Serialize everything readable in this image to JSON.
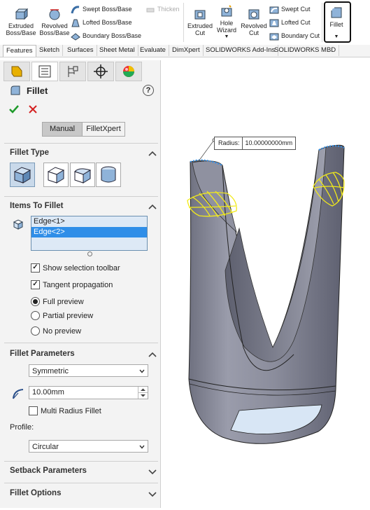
{
  "ribbon": {
    "extruded_boss": "Extruded Boss/Base",
    "revolved_boss": "Revolved Boss/Base",
    "swept_boss": "Swept Boss/Base",
    "lofted_boss": "Lofted Boss/Base",
    "boundary_boss": "Boundary Boss/Base",
    "thicken": "Thicken",
    "extruded_cut": "Extruded Cut",
    "hole_wizard": "Hole Wizard",
    "revolved_cut": "Revolved Cut",
    "swept_cut": "Swept Cut",
    "lofted_cut": "Lofted Cut",
    "boundary_cut": "Boundary Cut",
    "fillet": "Fillet"
  },
  "tabs": [
    "Features",
    "Sketch",
    "Surfaces",
    "Sheet Metal",
    "Evaluate",
    "DimXpert",
    "SOLIDWORKS Add-Ins",
    "SOLIDWORKS MBD"
  ],
  "pm": {
    "title": "Fillet",
    "help": "?",
    "mode_manual": "Manual",
    "mode_xpert": "FilletXpert",
    "fillet_type_title": "Fillet Type",
    "items_title": "Items To Fillet",
    "items": [
      "Edge<1>",
      "Edge<2>"
    ],
    "show_toolbar": "Show selection toolbar",
    "tangent": "Tangent propagation",
    "full_preview": "Full preview",
    "partial_preview": "Partial preview",
    "no_preview": "No preview",
    "params_title": "Fillet Parameters",
    "symmetric": "Symmetric",
    "radius": "10.00mm",
    "multi_radius": "Multi Radius Fillet",
    "profile_label": "Profile:",
    "profile_value": "Circular",
    "setback_title": "Setback Parameters",
    "options_title": "Fillet Options"
  },
  "viewport": {
    "callout_label": "Radius:",
    "callout_value": "10.00000000mm"
  },
  "colors": {
    "accent_green": "#1e9a2a",
    "cancel_red": "#d42020",
    "selection_blue": "#2f8ee8",
    "model_gray": "#8a8c9a",
    "preview_yellow": "#f2ea1a"
  }
}
